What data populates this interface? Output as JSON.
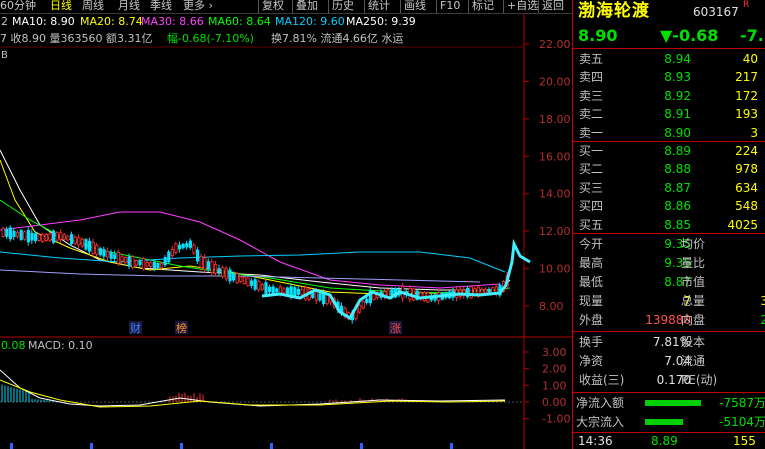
{
  "toolbar": {
    "items": [
      "60分钟",
      "日线",
      "周线",
      "月线",
      "季线",
      "更多 ›",
      "复权",
      "叠加",
      "历史",
      "统计",
      "画线",
      "F10",
      "标记",
      "+自选",
      "返回"
    ],
    "selected": "日线"
  },
  "ma_line": {
    "ma_prefix": "2",
    "ma10": "MA10: 8.90",
    "ma20": "MA20: 8.74",
    "ma30": "MA30: 8.66",
    "ma60": "MA60: 8.64",
    "ma120": "MA120: 9.60",
    "ma250": "MA250: 9.39"
  },
  "info_line": {
    "text1": "7 收8.90 量363560 额3.31亿",
    "change": "幅-0.68(-7.10%)",
    "text2": "换7.81% 流通4.66亿 水运"
  },
  "chart_left_marker": "B",
  "price_axis": [
    "22.00",
    "20.00",
    "18.00",
    "16.00",
    "14.00",
    "12.00",
    "10.00",
    "8.00"
  ],
  "macd_axis": [
    "3.00",
    "2.00",
    "1.00",
    "0.00",
    "-1.00"
  ],
  "macd_label": {
    "left": "0.08",
    "name": "MACD: 0.10"
  },
  "event_tags": [
    {
      "label": "财",
      "color": "#4080ff"
    },
    {
      "label": "榜",
      "color": "#ff9020"
    },
    {
      "label": "涨",
      "color": "#ff4040"
    }
  ],
  "stock": {
    "name": "渤海轮渡",
    "code": "603167",
    "badge": "R",
    "price": "8.90",
    "change": "▼-0.68",
    "pct": "-7."
  },
  "asks": [
    {
      "label": "卖五",
      "price": "8.94",
      "vol": "40"
    },
    {
      "label": "卖四",
      "price": "8.93",
      "vol": "217"
    },
    {
      "label": "卖三",
      "price": "8.92",
      "vol": "172"
    },
    {
      "label": "卖二",
      "price": "8.91",
      "vol": "193"
    },
    {
      "label": "卖一",
      "price": "8.90",
      "vol": "3"
    }
  ],
  "bids": [
    {
      "label": "买一",
      "price": "8.89",
      "vol": "224"
    },
    {
      "label": "买二",
      "price": "8.88",
      "vol": "978"
    },
    {
      "label": "买三",
      "price": "8.87",
      "vol": "634"
    },
    {
      "label": "买四",
      "price": "8.86",
      "vol": "548"
    },
    {
      "label": "买五",
      "price": "8.85",
      "vol": "4025"
    }
  ],
  "stats": [
    {
      "l1": "今开",
      "v1": "9.35",
      "c1": "grn",
      "l2": "均价"
    },
    {
      "l1": "最高",
      "v1": "9.35",
      "c1": "grn",
      "l2": "量比"
    },
    {
      "l1": "最低",
      "v1": "8.87",
      "c1": "grn",
      "l2": "市值"
    },
    {
      "l1": "现量",
      "v1": "7",
      "c1": "yel",
      "l2": "总量",
      "v2": "3"
    },
    {
      "l1": "外盘",
      "v1": "139880",
      "c1": "red",
      "l2": "内盘",
      "v2": "2"
    }
  ],
  "stats2": [
    {
      "l1": "换手",
      "v1": "7.81%",
      "l2": "股本"
    },
    {
      "l1": "净资",
      "v1": "7.04",
      "l2": "流通"
    },
    {
      "l1": "收益(三)",
      "v1": "0.170",
      "l2": "PE(动)"
    }
  ],
  "flows": [
    {
      "label": "净流入额",
      "value": "-7587万",
      "bar": 0.62
    },
    {
      "label": "大宗流入",
      "value": "-5104万",
      "bar": 0.42
    }
  ],
  "tick": {
    "time": "14:36",
    "price": "8.89",
    "vol": "155"
  },
  "colors": {
    "up": "#ff3030",
    "down": "#00e0ff",
    "ma5": "#ffffff",
    "ma10": "#ffff00",
    "ma20": "#ff00ff",
    "ma60": "#00ff00",
    "grid": "#8b0000"
  }
}
